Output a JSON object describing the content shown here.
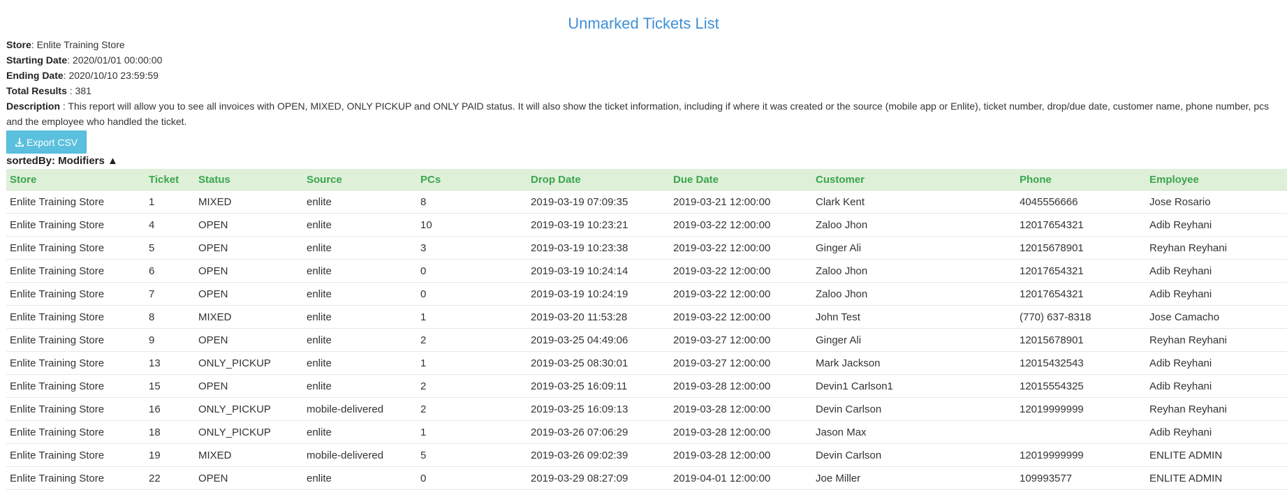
{
  "report": {
    "title": "Unmarked Tickets List",
    "store_label": "Store",
    "store_value": ": Enlite Training Store",
    "start_label": "Starting Date",
    "start_value": ": 2020/01/01 00:00:00",
    "end_label": "Ending Date",
    "end_value": ": 2020/10/10 23:59:59",
    "total_label": "Total Results",
    "total_value": " : 381",
    "desc_label": "Description",
    "desc_value": " : This report will allow you to see all invoices with OPEN, MIXED, ONLY PICKUP and ONLY PAID status. It will also show the ticket information, including if where it was created or the source (mobile app or Enlite), ticket number, drop/due date, customer name, phone number, pcs and the employee who handled the ticket.",
    "export_label": "Export CSV",
    "sorted_by": "sortedBy: Modifiers ▲"
  },
  "table": {
    "headers": [
      "Store",
      "Ticket",
      "Status",
      "Source",
      "PCs",
      "Drop Date",
      "Due Date",
      "Customer",
      "Phone",
      "Employee"
    ],
    "rows": [
      [
        "Enlite Training Store",
        "1",
        "MIXED",
        "enlite",
        "8",
        "2019-03-19 07:09:35",
        "2019-03-21 12:00:00",
        "Clark Kent",
        "4045556666",
        "Jose Rosario"
      ],
      [
        "Enlite Training Store",
        "4",
        "OPEN",
        "enlite",
        "10",
        "2019-03-19 10:23:21",
        "2019-03-22 12:00:00",
        "Zaloo Jhon",
        "12017654321",
        "Adib Reyhani"
      ],
      [
        "Enlite Training Store",
        "5",
        "OPEN",
        "enlite",
        "3",
        "2019-03-19 10:23:38",
        "2019-03-22 12:00:00",
        "Ginger Ali",
        "12015678901",
        "Reyhan Reyhani"
      ],
      [
        "Enlite Training Store",
        "6",
        "OPEN",
        "enlite",
        "0",
        "2019-03-19 10:24:14",
        "2019-03-22 12:00:00",
        "Zaloo Jhon",
        "12017654321",
        "Adib Reyhani"
      ],
      [
        "Enlite Training Store",
        "7",
        "OPEN",
        "enlite",
        "0",
        "2019-03-19 10:24:19",
        "2019-03-22 12:00:00",
        "Zaloo Jhon",
        "12017654321",
        "Adib Reyhani"
      ],
      [
        "Enlite Training Store",
        "8",
        "MIXED",
        "enlite",
        "1",
        "2019-03-20 11:53:28",
        "2019-03-22 12:00:00",
        "John Test",
        "(770) 637-8318",
        "Jose Camacho"
      ],
      [
        "Enlite Training Store",
        "9",
        "OPEN",
        "enlite",
        "2",
        "2019-03-25 04:49:06",
        "2019-03-27 12:00:00",
        "Ginger Ali",
        "12015678901",
        "Reyhan Reyhani"
      ],
      [
        "Enlite Training Store",
        "13",
        "ONLY_PICKUP",
        "enlite",
        "1",
        "2019-03-25 08:30:01",
        "2019-03-27 12:00:00",
        "Mark Jackson",
        "12015432543",
        "Adib Reyhani"
      ],
      [
        "Enlite Training Store",
        "15",
        "OPEN",
        "enlite",
        "2",
        "2019-03-25 16:09:11",
        "2019-03-28 12:00:00",
        "Devin1 Carlson1",
        "12015554325",
        "Adib Reyhani"
      ],
      [
        "Enlite Training Store",
        "16",
        "ONLY_PICKUP",
        "mobile-delivered",
        "2",
        "2019-03-25 16:09:13",
        "2019-03-28 12:00:00",
        "Devin Carlson",
        "12019999999",
        "Reyhan Reyhani"
      ],
      [
        "Enlite Training Store",
        "18",
        "ONLY_PICKUP",
        "enlite",
        "1",
        "2019-03-26 07:06:29",
        "2019-03-28 12:00:00",
        "Jason Max",
        "",
        "Adib Reyhani"
      ],
      [
        "Enlite Training Store",
        "19",
        "MIXED",
        "mobile-delivered",
        "5",
        "2019-03-26 09:02:39",
        "2019-03-28 12:00:00",
        "Devin Carlson",
        "12019999999",
        "ENLITE ADMIN"
      ],
      [
        "Enlite Training Store",
        "22",
        "OPEN",
        "enlite",
        "0",
        "2019-03-29 08:27:09",
        "2019-04-01 12:00:00",
        "Joe Miller",
        "109993577",
        "ENLITE ADMIN"
      ]
    ]
  }
}
